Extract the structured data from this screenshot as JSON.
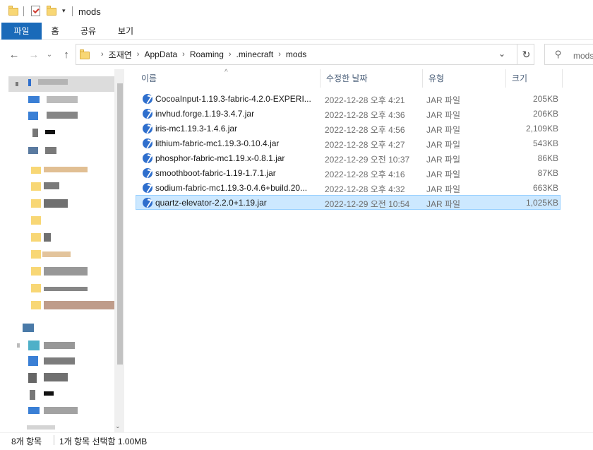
{
  "window": {
    "title": "mods"
  },
  "ribbon": {
    "tabs": [
      "파일",
      "홈",
      "공유",
      "보기"
    ]
  },
  "address": {
    "crumbs": [
      "조재연",
      "AppData",
      "Roaming",
      ".minecraft",
      "mods"
    ],
    "search_placeholder": "mods 검색"
  },
  "nav_icons": {
    "back": "back-arrow-icon",
    "forward": "forward-arrow-icon",
    "recent": "chevron-down-icon",
    "up": "up-arrow-icon",
    "refresh": "refresh-icon"
  },
  "columns": {
    "name": "이름",
    "date": "수정한 날짜",
    "type": "유형",
    "size": "크기"
  },
  "files": [
    {
      "name": "CocoaInput-1.19.3-fabric-4.2.0-EXPERI...",
      "date": "2022-12-28 오후 4:21",
      "type": "JAR 파일",
      "size": "205KB",
      "selected": false
    },
    {
      "name": "invhud.forge.1.19-3.4.7.jar",
      "date": "2022-12-28 오후 4:36",
      "type": "JAR 파일",
      "size": "206KB",
      "selected": false
    },
    {
      "name": "iris-mc1.19.3-1.4.6.jar",
      "date": "2022-12-28 오후 4:56",
      "type": "JAR 파일",
      "size": "2,109KB",
      "selected": false
    },
    {
      "name": "lithium-fabric-mc1.19.3-0.10.4.jar",
      "date": "2022-12-28 오후 4:27",
      "type": "JAR 파일",
      "size": "543KB",
      "selected": false
    },
    {
      "name": "phosphor-fabric-mc1.19.x-0.8.1.jar",
      "date": "2022-12-29 오전 10:37",
      "type": "JAR 파일",
      "size": "86KB",
      "selected": false
    },
    {
      "name": "smoothboot-fabric-1.19-1.7.1.jar",
      "date": "2022-12-28 오후 4:16",
      "type": "JAR 파일",
      "size": "87KB",
      "selected": false
    },
    {
      "name": "sodium-fabric-mc1.19.3-0.4.6+build.20...",
      "date": "2022-12-28 오후 4:32",
      "type": "JAR 파일",
      "size": "663KB",
      "selected": false
    },
    {
      "name": "quartz-elevator-2.2.0+1.19.jar",
      "date": "2022-12-29 오전 10:54",
      "type": "JAR 파일",
      "size": "1,025KB",
      "selected": true
    }
  ],
  "status": {
    "count": "8개 항목",
    "selection": "1개 항목 선택함 1.00MB"
  }
}
